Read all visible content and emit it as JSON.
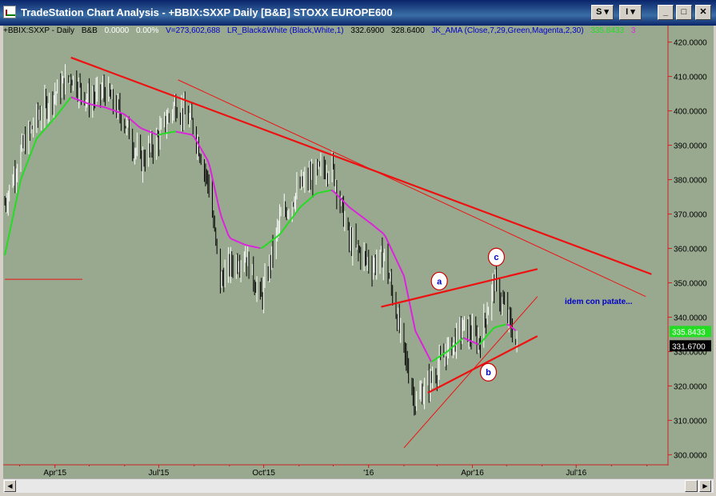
{
  "window": {
    "title": "TradeStation Chart Analysis - +BBIX:SXXP Daily [B&B] STOXX EUROPE600",
    "buttons": {
      "s_label": "S ▾",
      "i_label": "I ▾",
      "minimize": "_",
      "maximize": "□",
      "close": "✕"
    }
  },
  "legend": {
    "symbol": "+BBIX:SXXP - Daily",
    "bb": "B&B",
    "change": "0.0000",
    "change_pct": "0.00%",
    "volume": "V=273,602,688",
    "lr_study": "LR_Black&White (Black,White,1)",
    "lr_val1": "332.6900",
    "lr_val2": "328.6400",
    "ama_study": "JK_AMA (Close,7,29,Green,Magenta,2,30)",
    "ama_val": "335.8433",
    "ama_val2": "3"
  },
  "colors": {
    "background": "#99a98f",
    "price_up": "#ffffff",
    "price_down": "#000000",
    "ama_green": "#22dd22",
    "ama_magenta": "#dd22dd",
    "trendline": "#ee1111",
    "axis_label": "#000000",
    "axis_line": "#cc2222",
    "annotation": "#0000c8"
  },
  "annotation": {
    "text": "idem con patate..."
  },
  "chart_data": {
    "type": "line",
    "y_axis": {
      "min": 298,
      "max": 422,
      "ticks": [
        300,
        310,
        320,
        330,
        340,
        350,
        360,
        370,
        380,
        390,
        400,
        410,
        420
      ],
      "tick_labels": [
        "300.0000",
        "310.0000",
        "320.0000",
        "330.0000",
        "340.0000",
        "350.0000",
        "360.0000",
        "370.0000",
        "380.0000",
        "390.0000",
        "400.0000",
        "410.0000",
        "420.0000"
      ],
      "price_flags": [
        {
          "label": "335.8433",
          "value": 335.84,
          "color": "#22dd22"
        },
        {
          "label": "331.6700",
          "value": 331.67,
          "color": "#000000"
        }
      ]
    },
    "x_axis": {
      "min": "2015-02-16",
      "max": "2016-09-16",
      "ticks": [
        "2015-04-01",
        "2015-07-01",
        "2015-10-01",
        "2016-01-01",
        "2016-04-01",
        "2016-07-01"
      ],
      "tick_labels": [
        "Apr'15",
        "Jul'15",
        "Oct'15",
        "'16",
        "Apr'16",
        "Jul'16"
      ]
    },
    "series": [
      {
        "key": "close",
        "x": [
          "2015-02-16",
          "2015-03-02",
          "2015-03-16",
          "2015-04-01",
          "2015-04-15",
          "2015-05-01",
          "2015-05-15",
          "2015-06-01",
          "2015-06-15",
          "2015-06-30",
          "2015-07-15",
          "2015-07-31",
          "2015-08-14",
          "2015-08-24",
          "2015-09-01",
          "2015-09-15",
          "2015-09-29",
          "2015-10-15",
          "2015-11-02",
          "2015-11-16",
          "2015-11-30",
          "2015-12-15",
          "2016-01-04",
          "2016-01-15",
          "2016-02-01",
          "2016-02-11",
          "2016-02-25",
          "2016-03-10",
          "2016-03-24",
          "2016-04-07",
          "2016-04-20",
          "2016-05-02",
          "2016-05-10"
        ],
        "values": [
          373,
          388,
          398,
          405,
          410,
          403,
          406,
          397,
          385,
          392,
          402,
          396,
          378,
          350,
          355,
          358,
          345,
          368,
          378,
          382,
          384,
          362,
          355,
          358,
          330,
          315,
          322,
          330,
          337,
          333,
          350,
          340,
          331.67
        ]
      },
      {
        "key": "ama",
        "x": [
          "2015-02-16",
          "2015-03-02",
          "2015-03-16",
          "2015-04-01",
          "2015-04-15",
          "2015-05-01",
          "2015-05-15",
          "2015-06-01",
          "2015-06-15",
          "2015-06-30",
          "2015-07-15",
          "2015-07-31",
          "2015-08-14",
          "2015-08-24",
          "2015-09-01",
          "2015-09-15",
          "2015-09-29",
          "2015-10-15",
          "2015-11-02",
          "2015-11-16",
          "2015-11-30",
          "2015-12-15",
          "2016-01-04",
          "2016-01-15",
          "2016-02-01",
          "2016-02-11",
          "2016-02-25",
          "2016-03-10",
          "2016-03-24",
          "2016-04-07",
          "2016-04-20",
          "2016-05-02",
          "2016-05-10"
        ],
        "values": [
          358,
          380,
          392,
          398,
          404,
          402,
          401,
          399,
          395,
          393,
          394,
          393,
          385,
          370,
          363,
          361,
          360,
          364,
          372,
          376,
          377,
          372,
          367,
          364,
          352,
          336,
          327,
          330,
          334,
          332,
          337,
          338,
          335.84
        ]
      }
    ],
    "trendlines": [
      {
        "from": {
          "x": "2015-04-15",
          "y": 415.5
        },
        "to": {
          "x": "2016-09-05",
          "y": 352.5
        }
      },
      {
        "from": {
          "x": "2015-07-18",
          "y": 409
        },
        "to": {
          "x": "2016-08-31",
          "y": 346
        }
      },
      {
        "from": {
          "x": "2016-01-12",
          "y": 343
        },
        "to": {
          "x": "2016-05-28",
          "y": 354
        }
      },
      {
        "from": {
          "x": "2016-02-22",
          "y": 318
        },
        "to": {
          "x": "2016-05-28",
          "y": 334.5
        }
      },
      {
        "from": {
          "x": "2016-02-01",
          "y": 302
        },
        "to": {
          "x": "2016-05-28",
          "y": 346
        }
      },
      {
        "from": {
          "x": "2015-02-16",
          "y": 351
        },
        "to": {
          "x": "2015-04-25",
          "y": 351
        }
      }
    ],
    "labels": [
      {
        "text": "a",
        "x": "2016-03-03",
        "y": 350.5
      },
      {
        "text": "b",
        "x": "2016-04-15",
        "y": 324
      },
      {
        "text": "c",
        "x": "2016-04-22",
        "y": 357.5
      }
    ]
  }
}
